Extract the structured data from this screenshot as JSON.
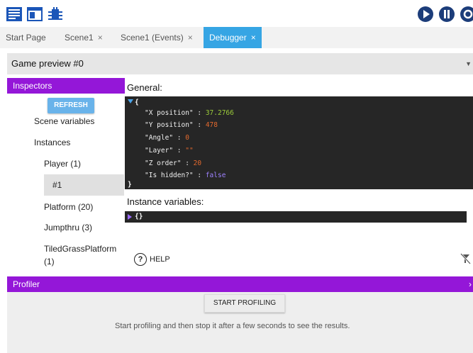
{
  "tabs": [
    {
      "label": "Start Page"
    },
    {
      "label": "Scene1",
      "close": "×"
    },
    {
      "label": "Scene1 (Events)",
      "close": "×"
    },
    {
      "label": "Debugger",
      "close": "×"
    }
  ],
  "preview": {
    "selected": "Game preview #0"
  },
  "inspectors": {
    "header": "Inspectors",
    "refresh_label": "REFRESH",
    "tree": [
      "Scene variables",
      "Instances",
      "Player (1)",
      "#1",
      "Platform (20)",
      "Jumpthru (3)",
      "TiledGrassPlatform",
      "(1)"
    ]
  },
  "general": {
    "title": "General:",
    "open_brace": "{",
    "close_brace": "}",
    "properties": [
      {
        "key": "\"X position\"",
        "value": "37.2766"
      },
      {
        "key": "\"Y position\"",
        "value": "478"
      },
      {
        "key": "\"Angle\"",
        "value": "0"
      },
      {
        "key": "\"Layer\"",
        "value": "\"\""
      },
      {
        "key": "\"Z order\"",
        "value": "20"
      },
      {
        "key": "\"Is hidden?\"",
        "value": "false"
      }
    ],
    "separator": " : "
  },
  "instance_variables": {
    "title": "Instance variables:",
    "value": "{}"
  },
  "help_label": "HELP",
  "help_glyph": "?",
  "profiler": {
    "header": "Profiler",
    "collapse_glyph": "›",
    "start_label": "START PROFILING",
    "message": "Start profiling and then stop it after a few seconds to see the results."
  },
  "colors": {
    "accent_purple": "#9417d8",
    "tab_active": "#36a5e4",
    "refresh_blue": "#69b3ea",
    "play_dark_blue": "#1c3d7a"
  },
  "icons": [
    "scene-list-icon",
    "window-icon",
    "debugger-bug-icon",
    "play-icon",
    "pause-icon",
    "refresh-circle-icon",
    "filter-off-icon",
    "help-circle-icon"
  ]
}
